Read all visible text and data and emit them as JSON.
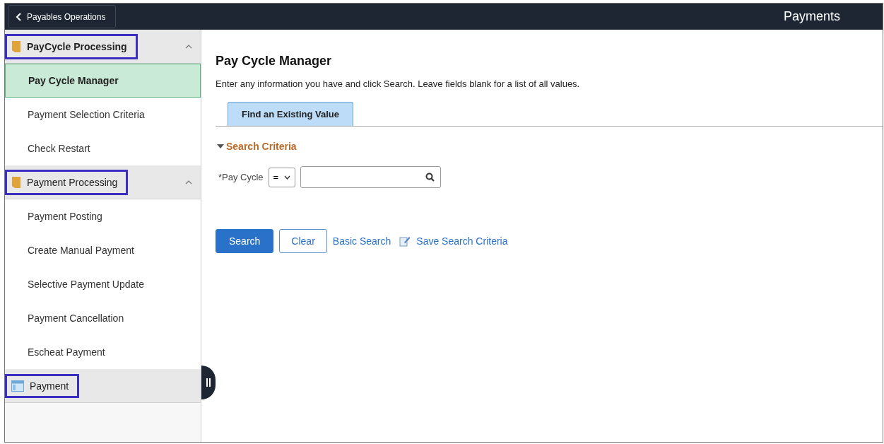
{
  "header": {
    "back_button": "Payables Operations",
    "title": "Payments"
  },
  "sidebar": {
    "groups": [
      {
        "kind": "folder",
        "label": "PayCycle Processing",
        "expanded": true,
        "highlighted": true,
        "items": [
          {
            "label": "Pay Cycle Manager",
            "selected": true
          },
          {
            "label": "Payment Selection Criteria",
            "selected": false
          },
          {
            "label": "Check Restart",
            "selected": false
          }
        ]
      },
      {
        "kind": "folder",
        "label": "Payment Processing",
        "expanded": true,
        "highlighted": true,
        "items": [
          {
            "label": "Payment Posting",
            "selected": false
          },
          {
            "label": "Create Manual Payment",
            "selected": false
          },
          {
            "label": "Selective Payment Update",
            "selected": false
          },
          {
            "label": "Payment Cancellation",
            "selected": false
          },
          {
            "label": "Escheat Payment",
            "selected": false
          }
        ]
      },
      {
        "kind": "page",
        "label": "Payment",
        "expanded": false,
        "highlighted": true
      }
    ]
  },
  "content": {
    "title": "Pay Cycle Manager",
    "instructions": "Enter any information you have and click Search. Leave fields blank for a list of all values.",
    "tabs": [
      {
        "label": "Find an Existing Value",
        "selected": true
      }
    ],
    "section": {
      "label": "Search Criteria",
      "expanded": true
    },
    "fields": [
      {
        "label": "*Pay Cycle",
        "operator": "="
      }
    ],
    "buttons": [
      {
        "kind": "primary",
        "label": "Search"
      },
      {
        "kind": "secondary",
        "label": "Clear"
      },
      {
        "kind": "link",
        "label": "Basic Search"
      },
      {
        "kind": "icon-link",
        "label": "Save Search Criteria"
      }
    ]
  }
}
